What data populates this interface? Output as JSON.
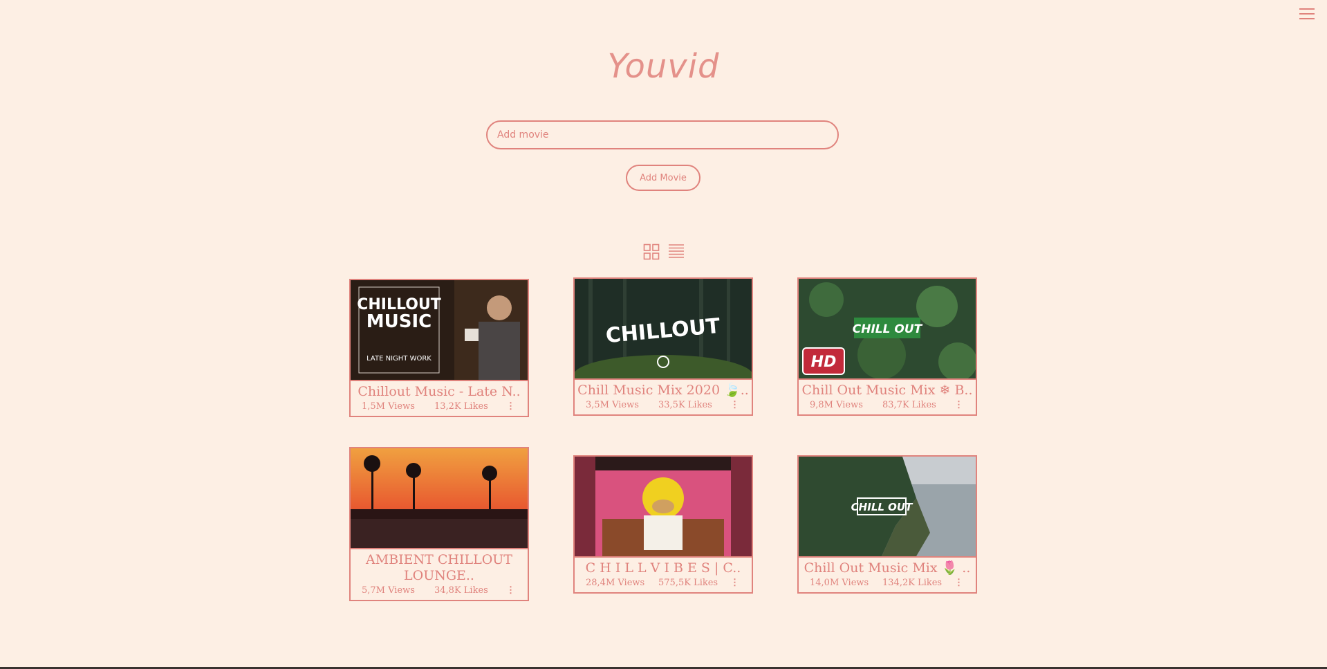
{
  "app": {
    "title": "Youvid"
  },
  "search": {
    "placeholder": "Add movie"
  },
  "add_button": {
    "label": "Add Movie"
  },
  "icons": {
    "menu": "hamburger-icon",
    "grid": "grid-view-icon",
    "list": "list-view-icon",
    "more": "more-vertical-icon"
  },
  "colors": {
    "background": "#fdefe4",
    "accent": "#e0837d"
  },
  "videos": [
    {
      "title": "Chillout Music - Late N..",
      "views": "1,5M Views",
      "likes": "13,2K Likes"
    },
    {
      "title": "Chill Music Mix 2020 🍃..",
      "views": "3,5M Views",
      "likes": "33,5K Likes"
    },
    {
      "title": "Chill Out Music Mix ❄ B..",
      "views": "9,8M Views",
      "likes": "83,7K Likes"
    },
    {
      "title": "AMBIENT CHILLOUT LOUNGE..",
      "views": "5,7M Views",
      "likes": "34,8K Likes"
    },
    {
      "title": "C H I L L V I B E S | C..",
      "views": "28,4M Views",
      "likes": "575,5K Likes"
    },
    {
      "title": "Chill Out Music Mix 🌷 ..",
      "views": "14,0M Views",
      "likes": "134,2K Likes"
    }
  ],
  "thumb_text": {
    "t1_line1": "CHILLOUT",
    "t1_line2": "MUSIC",
    "t1_line3": "LATE NIGHT WORK",
    "t2": "CHILLOUT",
    "t3": "CHILL OUT",
    "t3_badge": "HD",
    "t6": "CHILL OUT"
  }
}
